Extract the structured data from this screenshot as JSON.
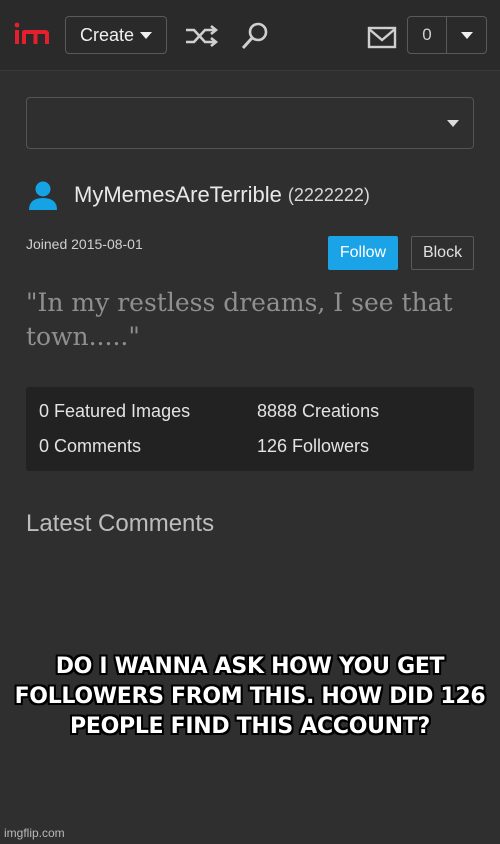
{
  "topbar": {
    "create_label": "Create",
    "notification_count": "0"
  },
  "icons": {
    "logo": "imgflip-logo",
    "shuffle": "shuffle-icon",
    "search": "search-icon",
    "mail": "mail-icon",
    "user": "user-icon"
  },
  "colors": {
    "follow_button": "#1aa3e6",
    "logo_red": "#e5202e",
    "user_icon": "#16a3e6"
  },
  "profile": {
    "username": "MyMemesAreTerrible",
    "user_id": "(2222222)",
    "joined": "Joined 2015-08-01",
    "follow_label": "Follow",
    "block_label": "Block",
    "quote": "\"In my restless dreams, I see that town.....\""
  },
  "stats": {
    "featured": "0 Featured Images",
    "creations": "8888 Creations",
    "comments": "0 Comments",
    "followers": "126 Followers"
  },
  "latest_comments_heading": "Latest Comments",
  "meme_caption": "DO I WANNA ASK HOW YOU GET FOLLOWERS FROM THIS. HOW DID 126 PEOPLE FIND THIS ACCOUNT?",
  "watermark": "imgflip.com"
}
